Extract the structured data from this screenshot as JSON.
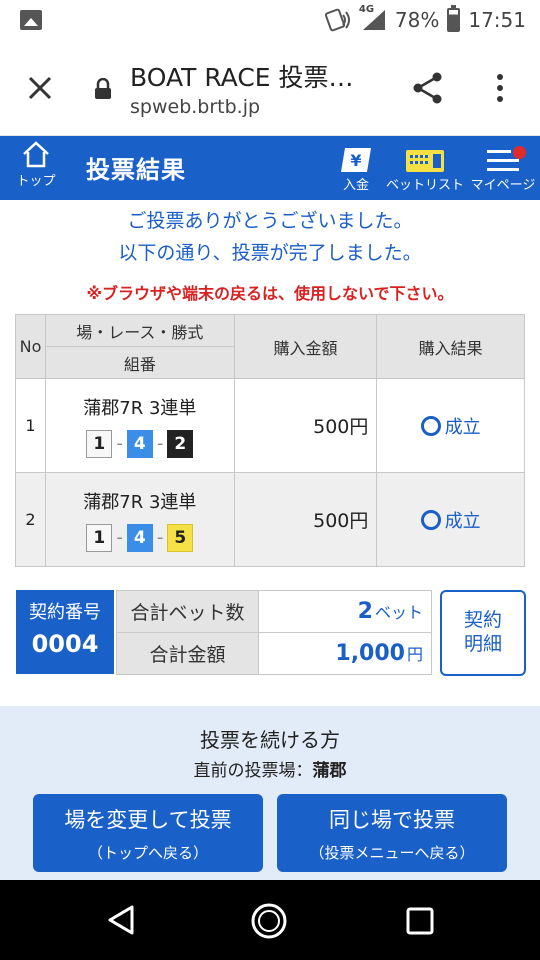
{
  "status_bar": {
    "network": "4G",
    "battery": "78%",
    "time": "17:51"
  },
  "browser": {
    "title": "BOAT RACE 投票…",
    "url": "spweb.brtb.jp"
  },
  "header": {
    "top_label": "トップ",
    "title": "投票結果",
    "deposit_label": "入金",
    "betlist_label": "ベットリスト",
    "mypage_label": "マイページ",
    "deposit_icon_glyph": "¥"
  },
  "messages": {
    "line1": "ご投票ありがとうございました。",
    "line2": "以下の通り、投票が完了しました。",
    "warning": "※ブラウザや端末の戻るは、使用しないで下さい。"
  },
  "table": {
    "headers": {
      "no": "No",
      "venue_race_type": "場・レース・勝式",
      "combination": "組番",
      "amount": "購入金額",
      "result": "購入結果"
    },
    "rows": [
      {
        "no": "1",
        "race": "蒲郡7R 3連単",
        "combo": [
          "1",
          "4",
          "2"
        ],
        "amount": "500円",
        "result": "成立"
      },
      {
        "no": "2",
        "race": "蒲郡7R 3連単",
        "combo": [
          "1",
          "4",
          "5"
        ],
        "amount": "500円",
        "result": "成立"
      }
    ],
    "separator": "-"
  },
  "summary": {
    "contract_label": "契約番号",
    "contract_no": "0004",
    "total_bets_label": "合計ベット数",
    "total_bets": "2",
    "bets_unit": "ベット",
    "total_amount_label": "合計金額",
    "total_amount": "1,000",
    "amount_unit": "円",
    "detail_line1": "契約",
    "detail_line2": "明細"
  },
  "continue": {
    "title": "投票を続ける方",
    "venue_prefix": "直前の投票場：",
    "venue": "蒲郡",
    "change_main": "場を変更して投票",
    "change_sub": "（トップへ戻る）",
    "same_main": "同じ場で投票",
    "same_sub": "（投票メニューへ戻る）"
  },
  "colors": {
    "accent": "#1a60c9",
    "link_blue": "#1a5ec8",
    "warning_red": "#d92121",
    "section_bg": "#e2ecf8"
  },
  "icons": [
    "gallery-icon",
    "nfc-icon",
    "signal-icon",
    "battery-icon",
    "close-icon",
    "lock-icon",
    "share-icon",
    "more-icon",
    "home-icon",
    "deposit-icon",
    "betlist-icon",
    "menu-icon",
    "back-icon",
    "home-circle-icon",
    "recent-icon"
  ]
}
